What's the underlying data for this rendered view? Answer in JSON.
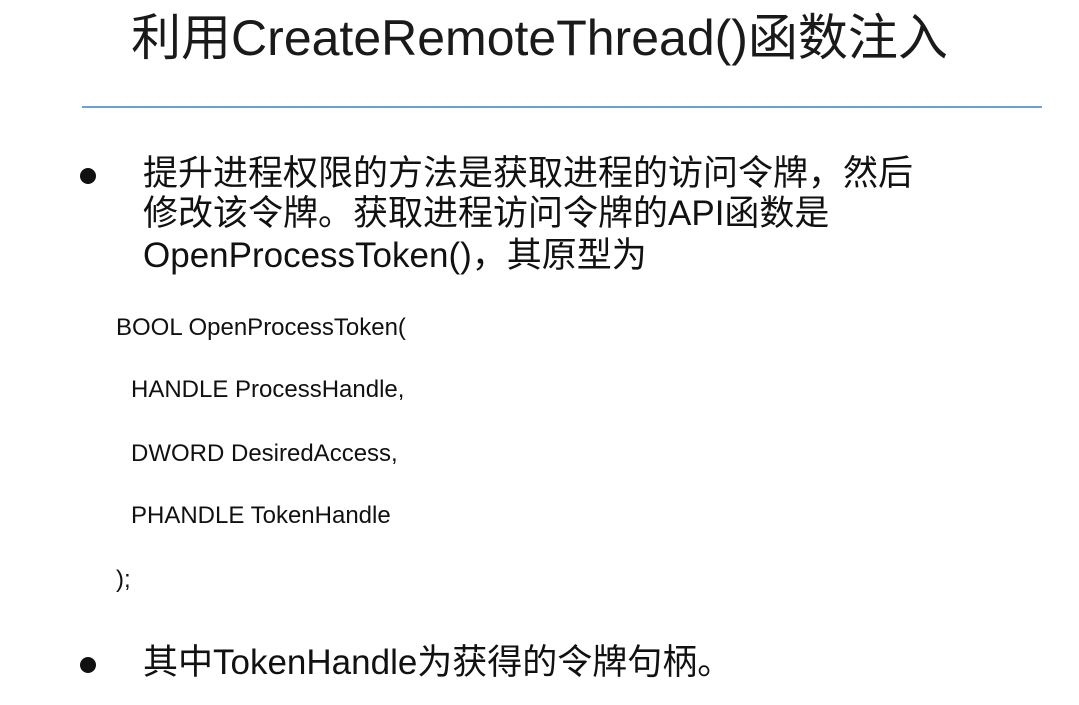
{
  "slide": {
    "title": "利用CreateRemoteThread()函数注入",
    "bullets": [
      {
        "lines": [
          "提升进程权限的方法是获取进程的访问令牌，然后",
          "修改该令牌。获取进程访问令牌的API函数是",
          "OpenProcessToken()，其原型为"
        ]
      },
      {
        "lines": [
          "其中TokenHandle为获得的令牌句柄。"
        ]
      }
    ],
    "code": [
      "BOOL OpenProcessToken(",
      "HANDLE ProcessHandle,",
      "DWORD DesiredAccess,",
      "PHANDLE TokenHandle",
      ");"
    ]
  },
  "colors": {
    "title_rule": "#6aa0d6",
    "text": "#111111"
  }
}
